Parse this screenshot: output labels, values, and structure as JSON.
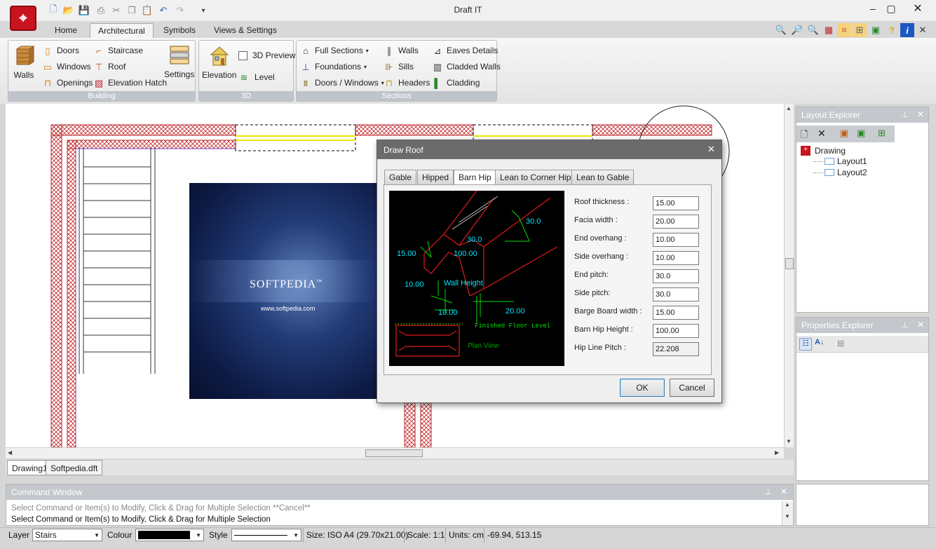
{
  "app": {
    "title": "Draft IT"
  },
  "ribbon_tabs": [
    "Home",
    "Architectural",
    "Symbols",
    "Views & Settings"
  ],
  "ribbon": {
    "building": {
      "title": "Building",
      "walls": "Walls",
      "doors": "Doors",
      "windows": "Windows",
      "openings": "Openings",
      "staircase": "Staircase",
      "roof": "Roof",
      "elevation_hatch": "Elevation Hatch",
      "settings": "Settings"
    },
    "threed": {
      "title": "3D",
      "elevation": "Elevation",
      "preview": "3D Preview",
      "level": "Level"
    },
    "sections": {
      "title": "Sections",
      "full_sections": "Full Sections",
      "foundations": "Foundations",
      "doors_windows": "Doors / Windows",
      "walls": "Walls",
      "sills": "Sills",
      "headers": "Headers",
      "eaves_details": "Eaves Details",
      "cladded_walls": "Cladded Walls",
      "cladding": "Cladding"
    }
  },
  "splash": {
    "brand": "SOFTPEDIA",
    "trademark": "™",
    "url": "www.softpedia.com"
  },
  "dialog": {
    "title": "Draw Roof",
    "tabs": [
      "Gable",
      "Hipped",
      "Barn Hip",
      "Lean to Corner Hip",
      "Lean to Gable"
    ],
    "active_tab": "Barn Hip",
    "diagram": {
      "dims": [
        "30.0",
        "30.0",
        "15.00",
        "100.00",
        "10.00",
        "10.00",
        "20.00"
      ],
      "wall_height": "Wall Height",
      "floor_level": "Finished Floor Level",
      "plan_view": "Plan View"
    },
    "fields": [
      {
        "label": "Roof thickness :",
        "value": "15.00"
      },
      {
        "label": "Facia width :",
        "value": "20.00"
      },
      {
        "label": "End overhang :",
        "value": "10.00"
      },
      {
        "label": "Side overhang :",
        "value": "10.00"
      },
      {
        "label": "End pitch:",
        "value": "30.0"
      },
      {
        "label": "Side pitch:",
        "value": "30.0"
      },
      {
        "label": "Barge Board width :",
        "value": "15.00"
      },
      {
        "label": "Barn Hip Height :",
        "value": "100.00"
      },
      {
        "label": "Hip Line Pitch :",
        "value": "22.208"
      }
    ],
    "ok": "OK",
    "cancel": "Cancel"
  },
  "doc_tabs": [
    "Drawing1",
    "Softpedia.dft"
  ],
  "command_window": {
    "title": "Command Window",
    "lines": [
      "Select Command or Item(s) to Modify, Click & Drag for Multiple Selection  **Cancel**",
      "Select Command or Item(s) to Modify, Click & Drag for Multiple Selection"
    ]
  },
  "layout_explorer": {
    "title": "Layout Explorer",
    "root": "Drawing",
    "children": [
      "Layout1",
      "Layout2"
    ]
  },
  "properties_explorer": {
    "title": "Properties Explorer"
  },
  "statusbar": {
    "layer_label": "Layer",
    "layer_value": "Stairs",
    "colour_label": "Colour",
    "style_label": "Style",
    "size": "Size: ISO A4 (29.70x21.00)",
    "scale": "Scale: 1:1",
    "units": "Units: cm",
    "coords": "-69.94, 513.15"
  },
  "colors": {
    "accent": "#c8141e",
    "wall_hatch": "#c0282d",
    "diagram_cyan": "#00e5ff",
    "diagram_green": "#00e000"
  }
}
